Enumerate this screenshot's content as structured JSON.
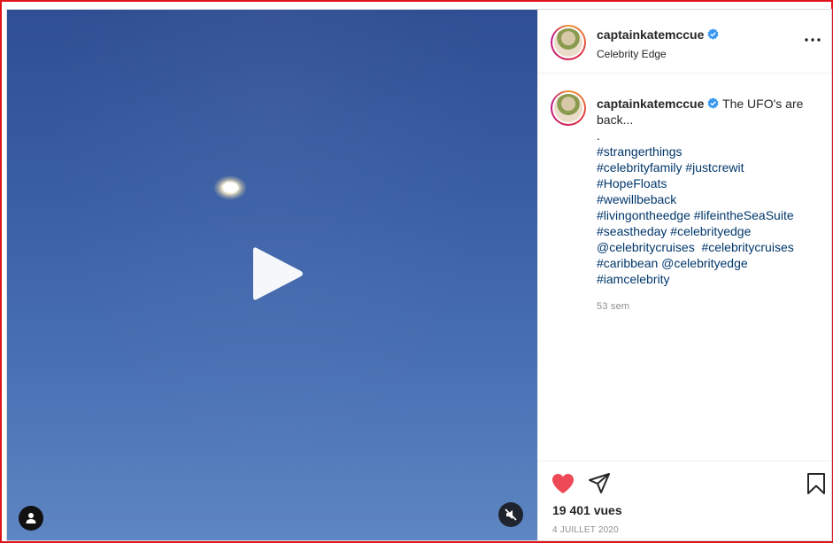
{
  "post": {
    "username": "captainkatemccue",
    "location": "Celebrity Edge",
    "caption": {
      "intro": "The UFO's are",
      "intro_line2": "back...",
      "dot": ".",
      "lines": [
        [
          {
            "t": "#strangerthings",
            "tag": true
          }
        ],
        [
          {
            "t": "#celebrityfamily",
            "tag": true
          },
          {
            "t": " ",
            "tag": false
          },
          {
            "t": "#justcrewit",
            "tag": true
          }
        ],
        [
          {
            "t": "#HopeFloats",
            "tag": true
          }
        ],
        [
          {
            "t": "#wewillbeback",
            "tag": true
          }
        ],
        [
          {
            "t": "#livingontheedge",
            "tag": true
          },
          {
            "t": " ",
            "tag": false
          },
          {
            "t": "#lifeintheSeaSuite",
            "tag": true
          }
        ],
        [
          {
            "t": "#seastheday",
            "tag": true
          },
          {
            "t": " ",
            "tag": false
          },
          {
            "t": "#celebrityedge",
            "tag": true
          }
        ],
        [
          {
            "t": "@celebritycruises",
            "tag": true
          },
          {
            "t": "  ",
            "tag": false
          },
          {
            "t": "#celebritycruises",
            "tag": true
          }
        ],
        [
          {
            "t": "#caribbean",
            "tag": true
          },
          {
            "t": " ",
            "tag": false
          },
          {
            "t": "@celebrityedge",
            "tag": true
          }
        ],
        [
          {
            "t": "#iamcelebrity",
            "tag": true
          }
        ]
      ]
    },
    "time_ago": "53 sem",
    "views": "19 401 vues",
    "date": "4 JUILLET 2020",
    "liked": true
  },
  "icons": {
    "verified": "verified-badge-icon",
    "more": "more-options-icon",
    "like": "heart-icon",
    "share": "paper-plane-icon",
    "save": "bookmark-icon",
    "play": "play-icon",
    "tagged_users": "user-icon",
    "mute": "speaker-muted-icon"
  },
  "colors": {
    "heart": "#ed4956",
    "verified": "#3897f0",
    "hashtag": "#00376b",
    "frame_border": "#e0141b"
  }
}
